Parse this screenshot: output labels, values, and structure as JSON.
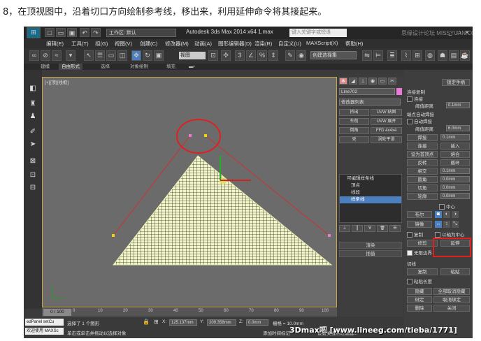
{
  "caption": "8，在顶视图中，沿着切口方向绘制参考线，移出来，利用延伸命令将其接起来。",
  "titlebar": {
    "workspace": "工作区: 默认",
    "app_title": "Autodesk 3ds Max  2014 x64",
    "file": "1.max",
    "search_placeholder": "键入关键字或短语",
    "site_logo": "思缘设计论坛 MISSYUAN.COM"
  },
  "menu": [
    "编辑(E)",
    "工具(T)",
    "组(G)",
    "视图(V)",
    "创建(C)",
    "修改器(M)",
    "动画(A)",
    "图形编辑器(D)",
    "渲染(R)",
    "自定义(U)",
    "MAXScript(X)",
    "帮助(H)"
  ],
  "toolbar": {
    "view_dropdown": "视图",
    "selection_set": "创建选择集"
  },
  "ribbon_tabs": [
    "建模",
    "自由形式",
    "选择",
    "对象绘制",
    "填充"
  ],
  "viewport": {
    "label": "[+][顶][线框]"
  },
  "timeline": {
    "slider": "0 / 100",
    "ticks": [
      "0",
      "10",
      "20",
      "30",
      "40",
      "50",
      "60",
      "70",
      "80",
      "90",
      "100"
    ]
  },
  "command_panel": {
    "object_name": "Line702",
    "modifier_list": "修改器列表",
    "buttons": [
      "挤出",
      "UVW 贴图",
      "车削",
      "UVW 展开",
      "倒角",
      "FFD 4x4x4",
      "壳",
      "涡轮平滑"
    ],
    "stack": [
      "可编辑样条线",
      "顶点",
      "线段",
      "样条线"
    ],
    "rollouts": [
      "渲染",
      "插值"
    ]
  },
  "right_panel": {
    "top_btn": "锁定手柄",
    "conn_copy": "连接复制",
    "connect": "连接",
    "thresh_label": "阈值距离",
    "thresh_val": "0.1mm",
    "end_weld": "端点自动焊接",
    "auto_weld": "自动焊接",
    "weld_thresh": "阈值距离",
    "weld_val": "6.0mm",
    "buttons": [
      [
        "焊接",
        "0.1mm"
      ],
      [
        "连接",
        "插入"
      ],
      [
        "设为首顶点",
        "熔合"
      ],
      [
        "反转",
        "循环"
      ],
      [
        "相交",
        "0.1mm"
      ],
      [
        "圆角",
        "0.0mm"
      ],
      [
        "切角",
        "0.0mm"
      ],
      [
        "轮廓",
        "0.0mm"
      ]
    ],
    "center": "中心",
    "boolean": "布尔",
    "mirror": "镜像",
    "copy": "复制",
    "about_pivot": "以轴为中心",
    "trim": "修剪",
    "extend": "延伸",
    "infinite": "无限边界",
    "tangent": "切线",
    "copy2": "复制",
    "paste": "粘贴",
    "paste_len": "粘贴长度",
    "hide": "隐藏",
    "unhide": "全部取消隐藏",
    "bind": "绑定",
    "unbind": "取消绑定",
    "delete": "删除",
    "close": "关闭"
  },
  "status": {
    "script1": "edPanel setCu",
    "script2": "欢迎使用 MAXSc",
    "selected": "选择了 1 个图形",
    "hint": "单击或单击并拖动以选择对象",
    "x_label": "X:",
    "x_val": "125.137mm",
    "y_label": "Y:",
    "y_val": "209.358mm",
    "z_label": "Z:",
    "z_val": "0.0mm",
    "grid": "栅格 = 10.0mm",
    "add_tag": "添加时间标记",
    "keyfilter": "设置关键点过滤器..."
  },
  "watermark": "3Dmax吧  [www.lineeg.com/tieba/1771]",
  "colors": {
    "accent": "#4b7fc0",
    "highlight": "#e02020",
    "mesh": "#e8f0b0",
    "viewport_border": "#c9a64a"
  }
}
